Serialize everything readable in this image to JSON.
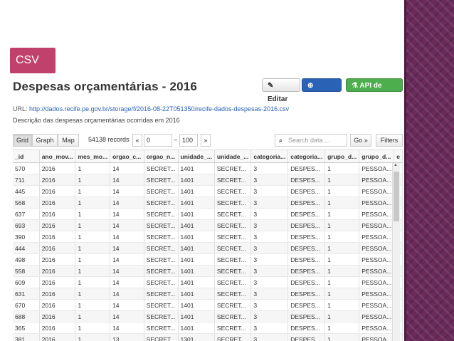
{
  "slide": {
    "tag": "CSV",
    "accent": "#c0416b",
    "band_color": "#6a2a5a"
  },
  "header": {
    "title": "Despesas orçamentárias - 2016",
    "edit_label": "Editar",
    "download_label": "Baixar",
    "api_label": "API de dados"
  },
  "info": {
    "url_label": "URL:",
    "url": "http://dados.recife.pe.gov.br/storage/f/2016-08-22T051350/recife-dados-despesas-2016.csv",
    "description": "Descrição das despesas orçamentárias ocorridas em 2016"
  },
  "toolbar": {
    "view_grid": "Grid",
    "view_graph": "Graph",
    "view_map": "Map",
    "records": "54138 records",
    "prev": "«",
    "from": "0",
    "dash": "–",
    "to": "100",
    "next": "»",
    "search_placeholder": "Search data ...",
    "go": "Go »",
    "filters": "Filters"
  },
  "table": {
    "columns": [
      "_id",
      "ano_mov...",
      "mes_mo...",
      "orgao_c...",
      "orgao_n...",
      "unidade_...",
      "unidade_...",
      "categoria...",
      "categoria...",
      "grupo_d...",
      "grupo_d...",
      "e"
    ],
    "rows": [
      [
        "570",
        "2016",
        "1",
        "14",
        "SECRET...",
        "1401",
        "SECRET...",
        "3",
        "DESPES...",
        "1",
        "PESSOA..."
      ],
      [
        "711",
        "2016",
        "1",
        "14",
        "SECRET...",
        "1401",
        "SECRET...",
        "3",
        "DESPES...",
        "1",
        "PESSOA..."
      ],
      [
        "445",
        "2016",
        "1",
        "14",
        "SECRET...",
        "1401",
        "SECRET...",
        "3",
        "DESPES...",
        "1",
        "PESSOA..."
      ],
      [
        "568",
        "2016",
        "1",
        "14",
        "SECRET...",
        "1401",
        "SECRET...",
        "3",
        "DESPES...",
        "1",
        "PESSOA..."
      ],
      [
        "637",
        "2016",
        "1",
        "14",
        "SECRET...",
        "1401",
        "SECRET...",
        "3",
        "DESPES...",
        "1",
        "PESSOA..."
      ],
      [
        "693",
        "2016",
        "1",
        "14",
        "SECRET...",
        "1401",
        "SECRET...",
        "3",
        "DESPES...",
        "1",
        "PESSOA..."
      ],
      [
        "390",
        "2016",
        "1",
        "14",
        "SECRET...",
        "1401",
        "SECRET...",
        "3",
        "DESPES...",
        "1",
        "PESSOA..."
      ],
      [
        "444",
        "2016",
        "1",
        "14",
        "SECRET...",
        "1401",
        "SECRET...",
        "3",
        "DESPES...",
        "1",
        "PESSOA..."
      ],
      [
        "498",
        "2016",
        "1",
        "14",
        "SECRET...",
        "1401",
        "SECRET...",
        "3",
        "DESPES...",
        "1",
        "PESSOA..."
      ],
      [
        "558",
        "2016",
        "1",
        "14",
        "SECRET...",
        "1401",
        "SECRET...",
        "3",
        "DESPES...",
        "1",
        "PESSOA..."
      ],
      [
        "609",
        "2016",
        "1",
        "14",
        "SECRET...",
        "1401",
        "SECRET...",
        "3",
        "DESPES...",
        "1",
        "PESSOA..."
      ],
      [
        "631",
        "2016",
        "1",
        "14",
        "SECRET...",
        "1401",
        "SECRET...",
        "3",
        "DESPES...",
        "1",
        "PESSOA..."
      ],
      [
        "670",
        "2016",
        "1",
        "14",
        "SECRET...",
        "1401",
        "SECRET...",
        "3",
        "DESPES...",
        "1",
        "PESSOA..."
      ],
      [
        "688",
        "2016",
        "1",
        "14",
        "SECRET...",
        "1401",
        "SECRET...",
        "3",
        "DESPES...",
        "1",
        "PESSOA..."
      ],
      [
        "365",
        "2016",
        "1",
        "14",
        "SECRET...",
        "1401",
        "SECRET...",
        "3",
        "DESPES...",
        "1",
        "PESSOA..."
      ],
      [
        "381",
        "2016",
        "1",
        "13",
        "SECRET...",
        "1301",
        "SECRET...",
        "3",
        "DESPES...",
        "1",
        "PESSOA..."
      ]
    ]
  }
}
